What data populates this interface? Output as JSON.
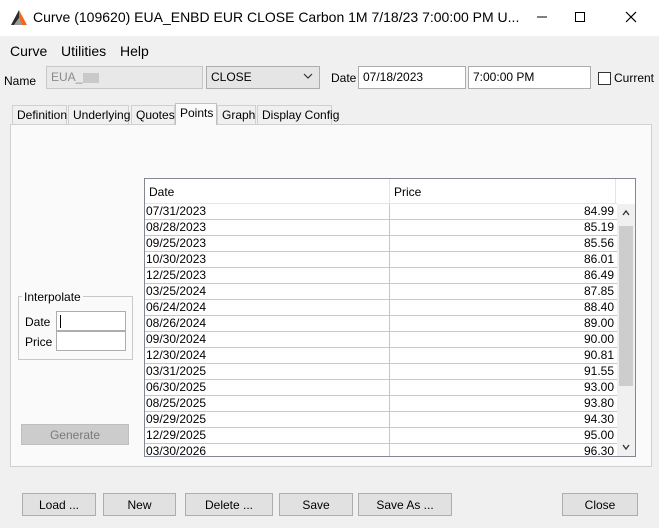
{
  "window": {
    "title": "Curve (109620) EUA_ENBD EUR CLOSE Carbon 1M 7/18/23 7:00:00 PM U...",
    "minimize": "—",
    "maximize": "☐",
    "close": "✕"
  },
  "menu": {
    "items": [
      "Curve",
      "Utilities",
      "Help"
    ]
  },
  "top": {
    "name_label": "Name",
    "name_value": "EUA_",
    "close_value": "CLOSE",
    "date_label": "Date",
    "date_value": "07/18/2023",
    "time_value": "7:00:00 PM",
    "current_label": "Current",
    "current_checked": false
  },
  "tabs": [
    "Definition",
    "Underlying",
    "Quotes",
    "Points",
    "Graph",
    "Display Config"
  ],
  "active_tab": "Points",
  "interpolate": {
    "title": "Interpolate",
    "date_label": "Date",
    "price_label": "Price",
    "date_value": "",
    "price_value": "",
    "generate_label": "Generate"
  },
  "table": {
    "columns": [
      "Date",
      "Price"
    ],
    "rows": [
      [
        "07/31/2023",
        "84.99"
      ],
      [
        "08/28/2023",
        "85.19"
      ],
      [
        "09/25/2023",
        "85.56"
      ],
      [
        "10/30/2023",
        "86.01"
      ],
      [
        "12/25/2023",
        "86.49"
      ],
      [
        "03/25/2024",
        "87.85"
      ],
      [
        "06/24/2024",
        "88.40"
      ],
      [
        "08/26/2024",
        "89.00"
      ],
      [
        "09/30/2024",
        "90.00"
      ],
      [
        "12/30/2024",
        "90.81"
      ],
      [
        "03/31/2025",
        "91.55"
      ],
      [
        "06/30/2025",
        "93.00"
      ],
      [
        "08/25/2025",
        "93.80"
      ],
      [
        "09/29/2025",
        "94.30"
      ],
      [
        "12/29/2025",
        "95.00"
      ],
      [
        "03/30/2026",
        "96.30"
      ]
    ]
  },
  "buttons": {
    "load": "Load ...",
    "new": "New",
    "delete": "Delete ...",
    "save": "Save",
    "save_as": "Save As ...",
    "close": "Close"
  },
  "colors": {
    "accent_orange": "#f26522",
    "accent_dark": "#2b2b2b"
  }
}
